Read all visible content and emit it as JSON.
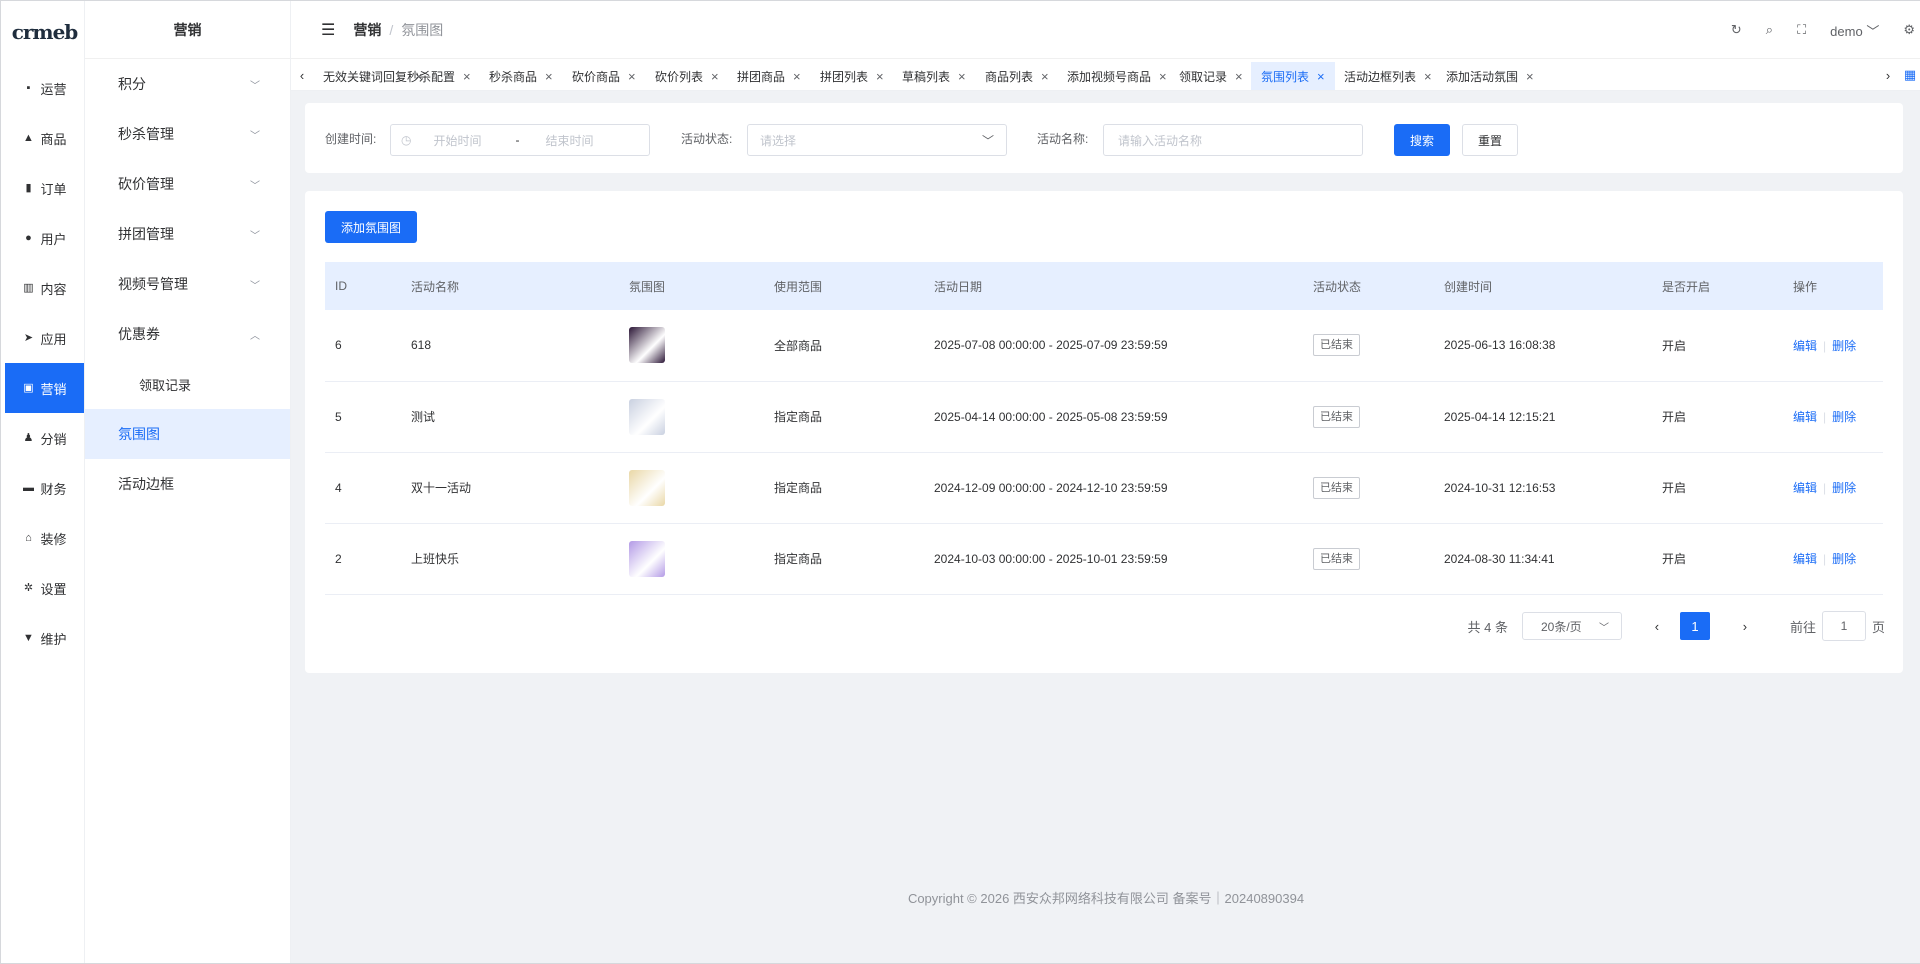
{
  "logo": "crmeb",
  "nav1": [
    {
      "label": "运营",
      "icon": "grid-icon"
    },
    {
      "label": "商品",
      "icon": "bag-icon"
    },
    {
      "label": "订单",
      "icon": "clipboard-icon"
    },
    {
      "label": "用户",
      "icon": "user-icon"
    },
    {
      "label": "内容",
      "icon": "chart-icon"
    },
    {
      "label": "应用",
      "icon": "send-icon"
    },
    {
      "label": "营销",
      "icon": "tag-icon"
    },
    {
      "label": "分销",
      "icon": "share-icon"
    },
    {
      "label": "财务",
      "icon": "wallet-icon"
    },
    {
      "label": "装修",
      "icon": "home-icon"
    },
    {
      "label": "设置",
      "icon": "gear-icon"
    },
    {
      "label": "维护",
      "icon": "tool-icon"
    }
  ],
  "nav2": {
    "title": "营销",
    "items": [
      "积分",
      "秒杀管理",
      "砍价管理",
      "拼团管理",
      "视频号管理",
      "优惠券"
    ],
    "coupon_sub": "领取记录",
    "leaf_active": "氛围图",
    "leaf_other": "活动边框"
  },
  "header": {
    "crumb_a": "营销",
    "crumb_sep": "/",
    "crumb_b": "氛围图",
    "user": "demo"
  },
  "tabs": [
    "无效关键词回复",
    "秒杀配置",
    "秒杀商品",
    "砍价商品",
    "砍价列表",
    "拼团商品",
    "拼团列表",
    "草稿列表",
    "商品列表",
    "添加视频号商品",
    "领取记录",
    "氛围列表",
    "活动边框列表",
    "添加活动氛围"
  ],
  "active_tab_index": 11,
  "filter": {
    "created_label": "创建时间:",
    "start_placeholder": "开始时间",
    "range_sep": "-",
    "end_placeholder": "结束时间",
    "status_label": "活动状态:",
    "status_placeholder": "请选择",
    "name_label": "活动名称:",
    "name_placeholder": "请输入活动名称",
    "search": "搜索",
    "reset": "重置"
  },
  "add_button": "添加氛围图",
  "table": {
    "headers": [
      "ID",
      "活动名称",
      "氛围图",
      "使用范围",
      "活动日期",
      "活动状态",
      "创建时间",
      "是否开启",
      "操作"
    ],
    "rows": [
      {
        "id": "6",
        "name": "618",
        "scope": "全部商品",
        "date": "2025-07-08 00:00:00 - 2025-07-09 23:59:59",
        "status": "已结束",
        "created": "2025-06-13 16:08:38",
        "enabled": "开启",
        "thumb": "#2b1636"
      },
      {
        "id": "5",
        "name": "测试",
        "scope": "指定商品",
        "date": "2025-04-14 00:00:00 - 2025-05-08 23:59:59",
        "status": "已结束",
        "created": "2025-04-14 12:15:21",
        "enabled": "开启",
        "thumb": "#c9d0e0"
      },
      {
        "id": "4",
        "name": "双十一活动",
        "scope": "指定商品",
        "date": "2024-12-09 00:00:00 - 2024-12-10 23:59:59",
        "status": "已结束",
        "created": "2024-10-31 12:16:53",
        "enabled": "开启",
        "thumb": "#e9d7a6"
      },
      {
        "id": "2",
        "name": "上班快乐",
        "scope": "指定商品",
        "date": "2024-10-03 00:00:00 - 2025-10-01 23:59:59",
        "status": "已结束",
        "created": "2024-08-30 11:34:41",
        "enabled": "开启",
        "thumb": "#b39ae6"
      }
    ],
    "edit": "编辑",
    "op_sep": "|",
    "delete": "删除"
  },
  "pager": {
    "total": "共 4 条",
    "page_size": "20条/页",
    "current": "1",
    "goto_label": "前往",
    "goto_value": "1",
    "page_unit": "页"
  },
  "footer": "Copyright © 2026 西安众邦网络科技有限公司 备案号｜20240890394"
}
